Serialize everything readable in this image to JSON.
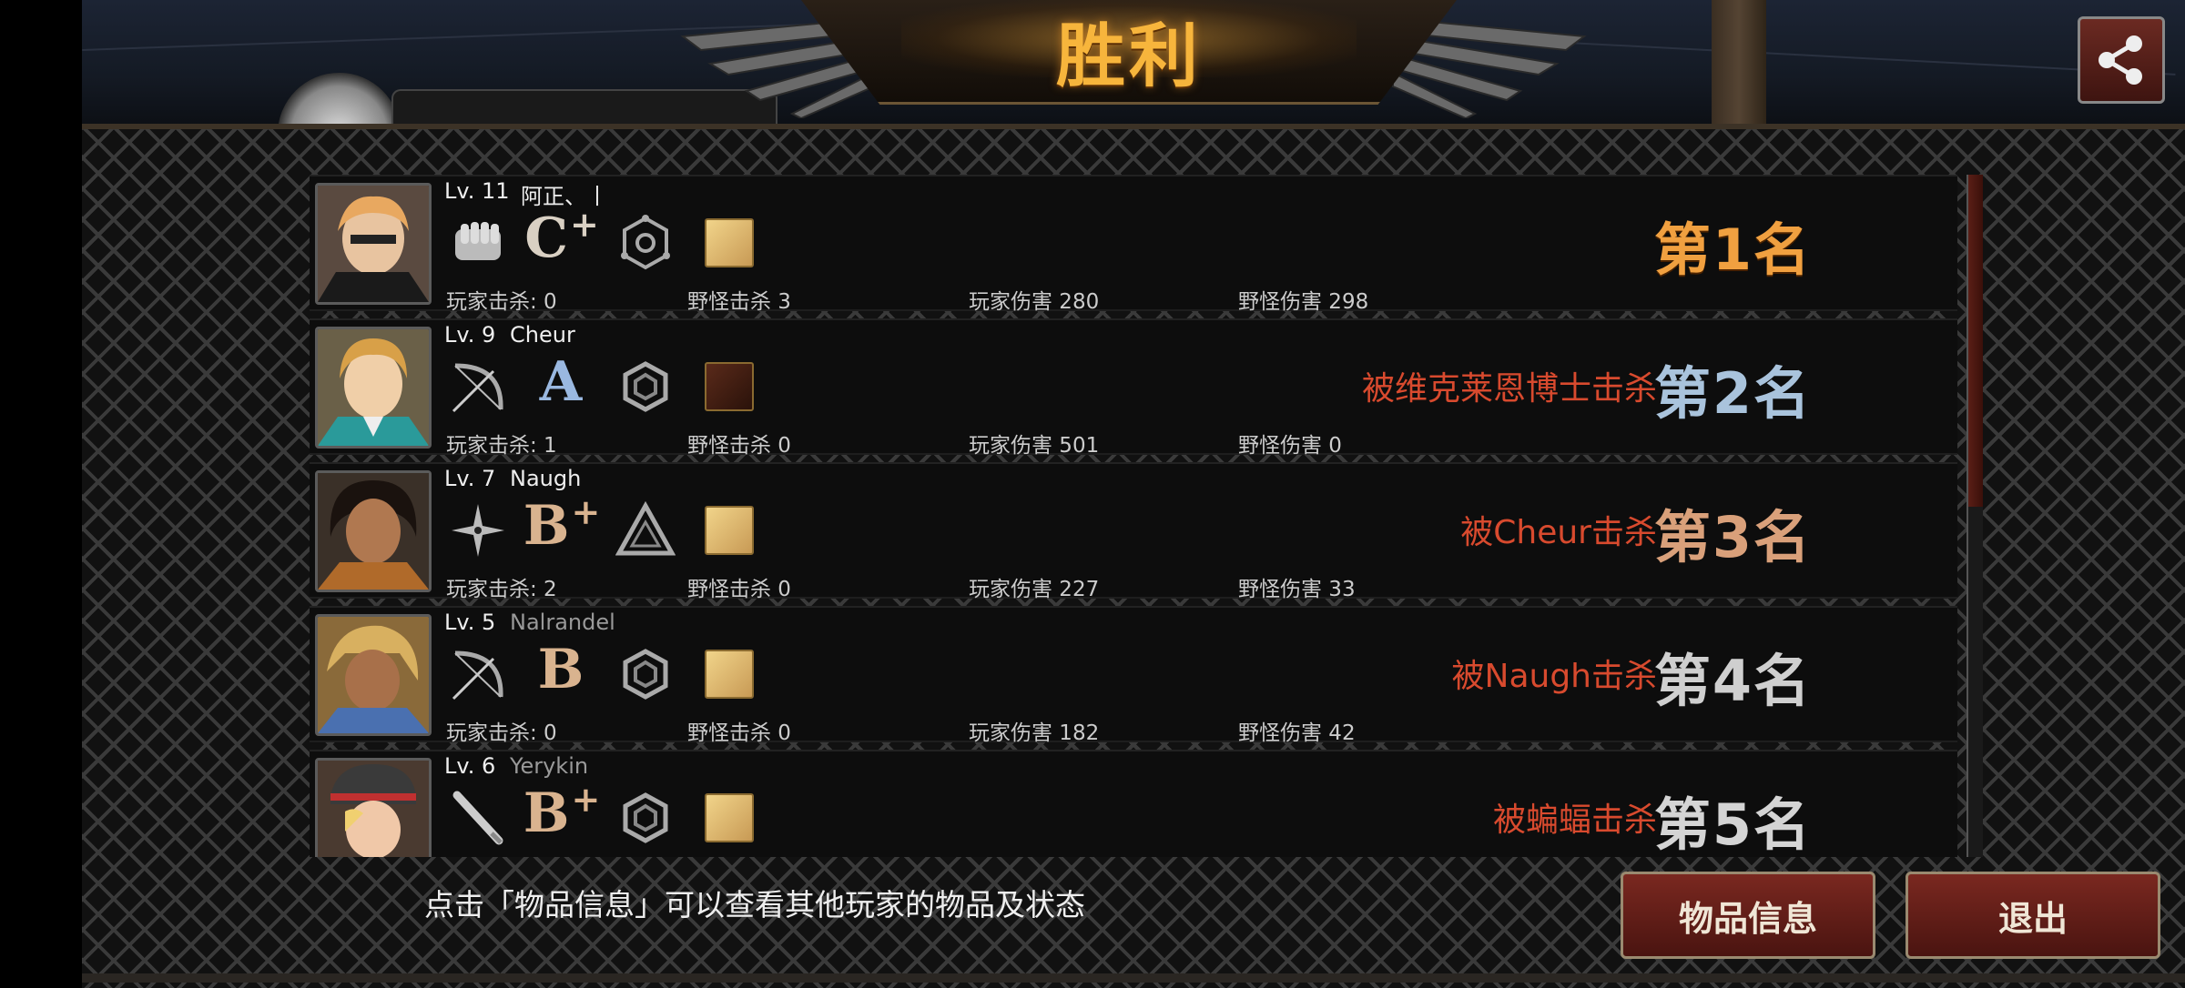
{
  "header": {
    "title": "胜利",
    "partial_name": "阿正、丨"
  },
  "players": [
    {
      "level": "Lv. 11",
      "name": "阿正、丨",
      "weapon_icon": "fist-icon",
      "grade": "C",
      "grade_plus": "+",
      "skill_icon": "hexagon-orbit-icon",
      "item_icon": "pale-item-icon",
      "stats": {
        "player_kills": "玩家击杀: 0",
        "monster_kills": "野怪击杀 3",
        "player_damage": "玩家伤害 280",
        "monster_damage": "野怪伤害 298"
      },
      "killed_by": "",
      "rank": "第1名"
    },
    {
      "level": "Lv. 9",
      "name": "Cheur",
      "weapon_icon": "bow-icon",
      "grade": "A",
      "grade_plus": "",
      "skill_icon": "hexagon-swirl-icon",
      "item_icon": "dark-item-icon",
      "stats": {
        "player_kills": "玩家击杀: 1",
        "monster_kills": "野怪击杀 0",
        "player_damage": "玩家伤害 501",
        "monster_damage": "野怪伤害 0"
      },
      "killed_by": "被维克莱恩博士击杀",
      "rank": "第2名"
    },
    {
      "level": "Lv. 7",
      "name": "Naugh",
      "weapon_icon": "shuriken-icon",
      "grade": "B",
      "grade_plus": "+",
      "skill_icon": "triangle-icon",
      "item_icon": "pale-item-icon",
      "stats": {
        "player_kills": "玩家击杀: 2",
        "monster_kills": "野怪击杀 0",
        "player_damage": "玩家伤害 227",
        "monster_damage": "野怪伤害 33"
      },
      "killed_by": "被Cheur击杀",
      "rank": "第3名"
    },
    {
      "level": "Lv. 5",
      "name": "Nalrandel",
      "weapon_icon": "bow-icon",
      "grade": "B",
      "grade_plus": "",
      "skill_icon": "hexagon-swirl-icon",
      "item_icon": "pale-item-icon",
      "stats": {
        "player_kills": "玩家击杀: 0",
        "monster_kills": "野怪击杀 0",
        "player_damage": "玩家伤害 182",
        "monster_damage": "野怪伤害 42"
      },
      "killed_by": "被Naugh击杀",
      "rank": "第4名"
    },
    {
      "level": "Lv. 6",
      "name": "Yerykin",
      "weapon_icon": "bat-icon",
      "grade": "B",
      "grade_plus": "+",
      "skill_icon": "hexagon-swirl-icon",
      "item_icon": "pale-item-icon",
      "stats": {
        "player_kills": "",
        "monster_kills": "",
        "player_damage": "",
        "monster_damage": ""
      },
      "killed_by": "被蝙蝠击杀",
      "rank": "第5名"
    }
  ],
  "footer": {
    "tip": "点击「物品信息」可以查看其他玩家的物品及状态",
    "items_button": "物品信息",
    "exit_button": "退出"
  },
  "colors": {
    "title_gold": "#f7b53c",
    "killed_by_red": "#d84a2e",
    "rank1": "#f0a040",
    "button_red": "#7a2820"
  }
}
